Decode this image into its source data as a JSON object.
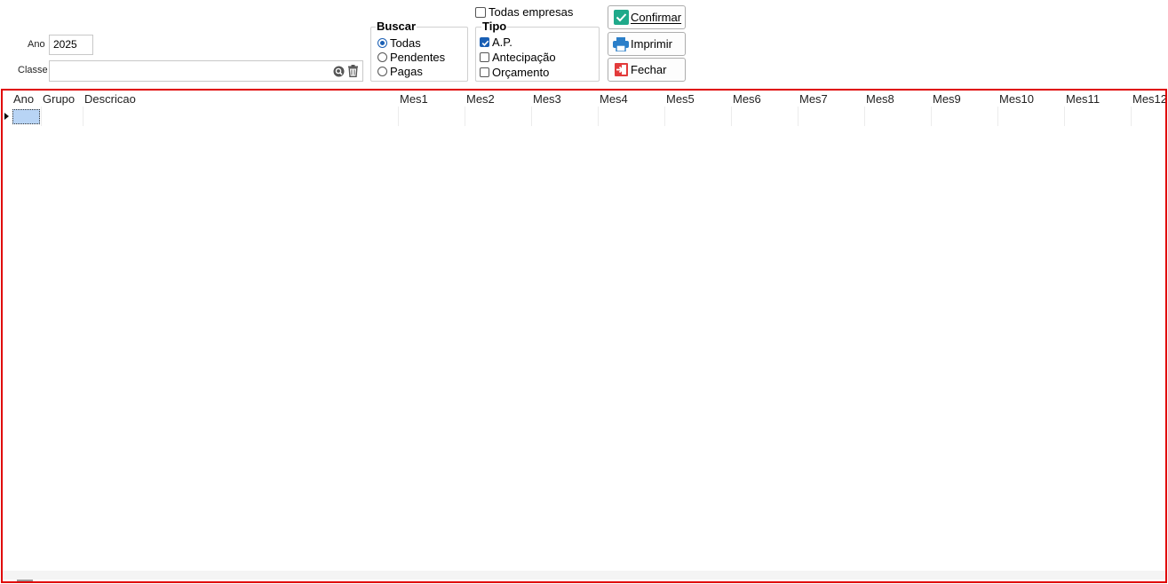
{
  "filters": {
    "ano_label": "Ano",
    "ano_value": "2025",
    "classe_label": "Classe",
    "classe_value": ""
  },
  "buscar": {
    "title": "Buscar",
    "options": [
      {
        "label": "Todas",
        "selected": true
      },
      {
        "label": "Pendentes",
        "selected": false
      },
      {
        "label": "Pagas",
        "selected": false
      }
    ]
  },
  "todas_empresas": {
    "label": "Todas empresas",
    "checked": false
  },
  "tipo": {
    "title": "Tipo",
    "options": [
      {
        "label": "A.P.",
        "checked": true
      },
      {
        "label": "Antecipação",
        "checked": false
      },
      {
        "label": "Orçamento",
        "checked": false
      }
    ]
  },
  "actions": {
    "confirmar": "Confirmar",
    "imprimir": "Imprimir",
    "fechar": "Fechar"
  },
  "grid": {
    "columns": [
      "Ano",
      "Grupo",
      "Descricao",
      "Mes1",
      "Mes2",
      "Mes3",
      "Mes4",
      "Mes5",
      "Mes6",
      "Mes7",
      "Mes8",
      "Mes9",
      "Mes10",
      "Mes11",
      "Mes12"
    ],
    "rows": []
  },
  "colors": {
    "grid_border": "#e00000",
    "selection": "#b8d4f5",
    "accent": "#1a5fb4"
  }
}
